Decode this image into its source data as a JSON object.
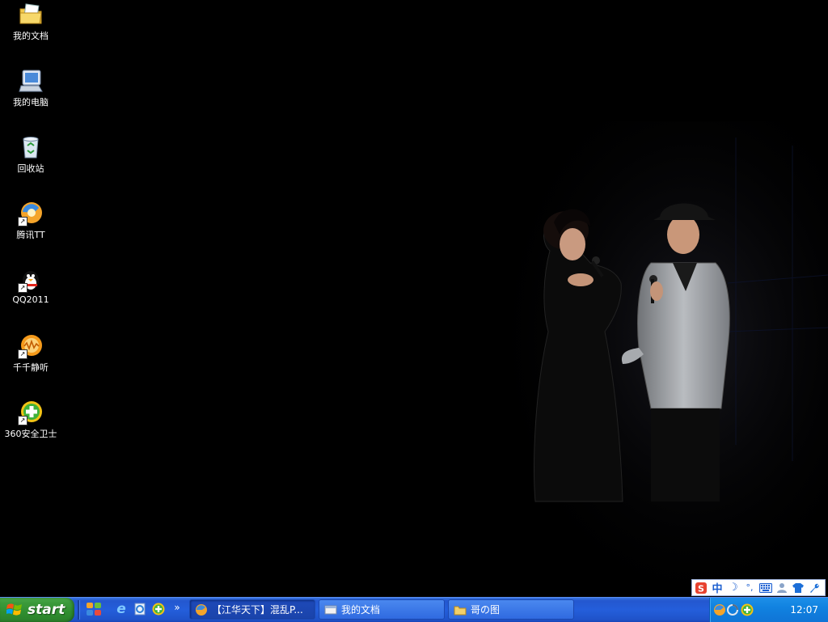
{
  "desktop": {
    "icons": [
      {
        "label": "我的文档",
        "icon": "my-documents-folder-icon"
      },
      {
        "label": "我的电脑",
        "icon": "my-computer-icon"
      },
      {
        "label": "回收站",
        "icon": "recycle-bin-icon"
      },
      {
        "label": "腾讯TT",
        "icon": "tencent-tt-browser-icon"
      },
      {
        "label": "QQ2011",
        "icon": "qq-penguin-icon"
      },
      {
        "label": "千千静听",
        "icon": "ttplayer-icon"
      },
      {
        "label": "360安全卫士",
        "icon": "360-safeguard-icon"
      }
    ],
    "wallpaper": "concert-stage-photo"
  },
  "ime_bar": {
    "mode_label": "中",
    "icons": [
      "sogou-s-icon",
      "chinese-mode",
      "half-moon-icon",
      "punctuation-icon",
      "keyboard-icon",
      "user-icon",
      "shirt-skin-icon",
      "wrench-icon"
    ]
  },
  "taskbar": {
    "start_label": "start",
    "quick_launch_expand": "»",
    "tasks": [
      {
        "label": "【江华天下】混乱P...",
        "icon": "tt-browser-icon",
        "active": true
      },
      {
        "label": "我的文档",
        "icon": "document-window-icon",
        "active": false
      },
      {
        "label": "哥の图",
        "icon": "folder-icon",
        "active": false
      }
    ],
    "clock": "12:07"
  },
  "colors": {
    "taskbar_blue": "#245edb",
    "start_green": "#3c9b3c",
    "tray_blue": "#1182e0"
  }
}
